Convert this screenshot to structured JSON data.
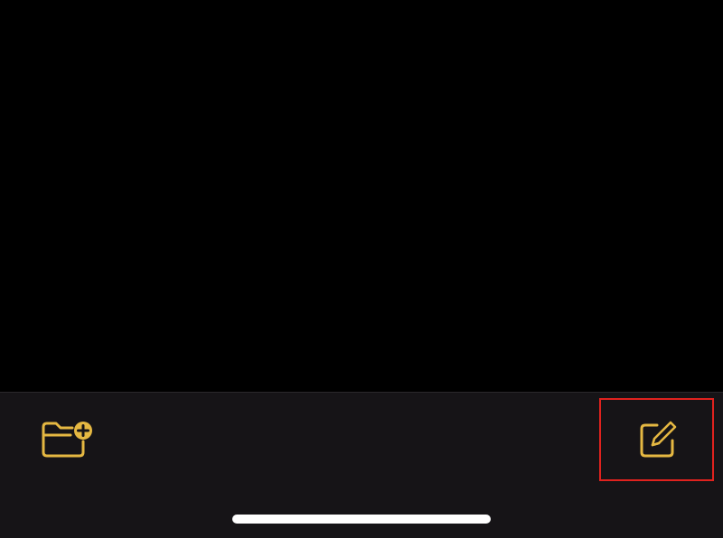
{
  "accent_color": "#E5B842",
  "highlight_color": "#E0221E",
  "toolbar": {
    "background": "#161417",
    "new_folder": {
      "icon": "folder-plus-icon"
    },
    "compose": {
      "icon": "compose-icon",
      "highlighted": true
    }
  },
  "home_indicator": {
    "color": "#FFFFFF"
  }
}
